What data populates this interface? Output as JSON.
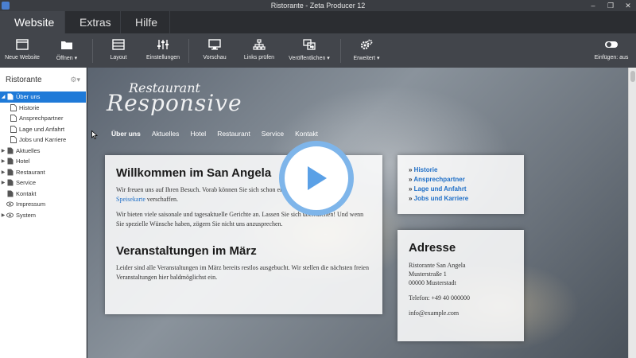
{
  "window": {
    "title": "Ristorante - Zeta Producer 12"
  },
  "tabs": [
    {
      "label": "Website"
    },
    {
      "label": "Extras"
    },
    {
      "label": "Hilfe"
    }
  ],
  "ribbon": {
    "new_website": "Neue Website",
    "open": "Öffnen ▾",
    "layout": "Layout",
    "settings": "Einstellungen",
    "preview": "Vorschau",
    "check_links": "Links prüfen",
    "publish": "Veröffentlichen ▾",
    "advanced": "Erweitert ▾",
    "insert": "Einfügen: aus"
  },
  "sidebar": {
    "title": "Ristorante",
    "items": [
      {
        "label": "Über uns"
      },
      {
        "label": "Historie"
      },
      {
        "label": "Ansprechpartner"
      },
      {
        "label": "Lage und Anfahrt"
      },
      {
        "label": "Jobs und Karriere"
      },
      {
        "label": "Aktuelles"
      },
      {
        "label": "Hotel"
      },
      {
        "label": "Restaurant"
      },
      {
        "label": "Service"
      },
      {
        "label": "Kontakt"
      },
      {
        "label": "Impressum"
      },
      {
        "label": "System"
      }
    ]
  },
  "site": {
    "logo_top": "Restaurant",
    "logo_main": "Responsive",
    "nav": [
      "Über uns",
      "Aktuelles",
      "Hotel",
      "Restaurant",
      "Service",
      "Kontakt"
    ],
    "welcome_title": "Willkommen im San Angela",
    "welcome_p1_a": "Wir freuen uns auf Ihren Besuch. Vorab können Sie sich schon einen Überblick über unsere ",
    "welcome_p1_link": "Speisekarte",
    "welcome_p1_b": " verschaffen.",
    "welcome_p2": "Wir bieten viele saisonale und tagesaktuelle Gerichte an. Lassen Sie sich überraschen! Und wenn Sie spezielle Wünsche haben, zögern Sie nicht uns anzusprechen.",
    "events_title": "Veranstaltungen im März",
    "events_p": "Leider sind alle Veranstaltungen im März bereits restlos ausgebucht. Wir stellen die nächsten freien Veranstaltungen hier baldmöglichst ein.",
    "links": [
      "Historie",
      "Ansprechpartner",
      "Lage und Anfahrt",
      "Jobs und Karriere"
    ],
    "address_title": "Adresse",
    "address_lines": [
      "Ristorante San Angela",
      "Musterstraße 1",
      "00000 Musterstadt"
    ],
    "phone": "Telefon: +49 40 000000",
    "email": "info@example.com"
  },
  "colors": {
    "accent": "#1f7ad8",
    "play_ring": "#7eb5ea",
    "link": "#1f6fc7"
  }
}
